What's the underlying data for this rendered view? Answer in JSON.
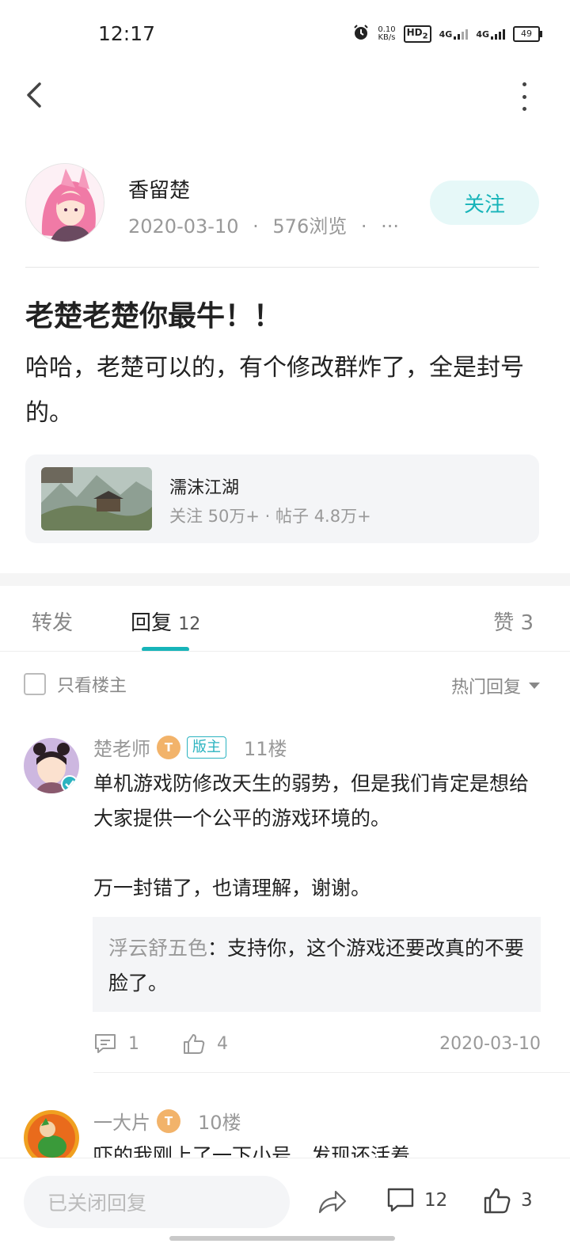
{
  "status_bar": {
    "time": "12:17",
    "net_speed_value": "0.10",
    "net_speed_unit": "KB/s",
    "hd_label": "HD",
    "hd_sub": "2",
    "sig1": "4G",
    "sig2": "4G",
    "battery": "49"
  },
  "author": {
    "name": "香留楚",
    "date": "2020-03-10",
    "views": "576浏览",
    "sep": "·",
    "ellipsis": "···",
    "follow_label": "关注"
  },
  "post": {
    "title": "老楚老楚你最牛！！",
    "body": "哈哈，老楚可以的，有个修改群炸了，全是封号的。"
  },
  "forum": {
    "name": "濡沫江湖",
    "stats": "关注 50万+ · 帖子 4.8万+"
  },
  "tabs": {
    "forward": "转发",
    "reply": "回复",
    "reply_count": "12",
    "like": "赞 3"
  },
  "filter": {
    "only_owner": "只看楼主",
    "sort": "热门回复"
  },
  "replies": [
    {
      "user": "楚老师",
      "level": "T",
      "badge": "版主",
      "floor": "11楼",
      "text1": "单机游戏防修改天生的弱势，但是我们肯定是想给大家提供一个公平的游戏环境的。",
      "text2": "万一封错了，也请理解，谢谢。",
      "quote_user": "浮云舒五色",
      "quote_colon": "：",
      "quote_text": "支持你，这个游戏还要改真的不要脸了。",
      "comments": "1",
      "likes": "4",
      "date": "2020-03-10"
    },
    {
      "user": "一大片",
      "level": "T",
      "floor": "10楼",
      "text1": "吓的我刚上了一下小号，发现还活着"
    }
  ],
  "bottom_bar": {
    "reply_placeholder": "已关闭回复",
    "comment_count": "12",
    "like_count": "3"
  },
  "colors": {
    "accent": "#17b4b9",
    "follow_bg": "#e6f8f8",
    "level_badge": "#f2b36a"
  }
}
